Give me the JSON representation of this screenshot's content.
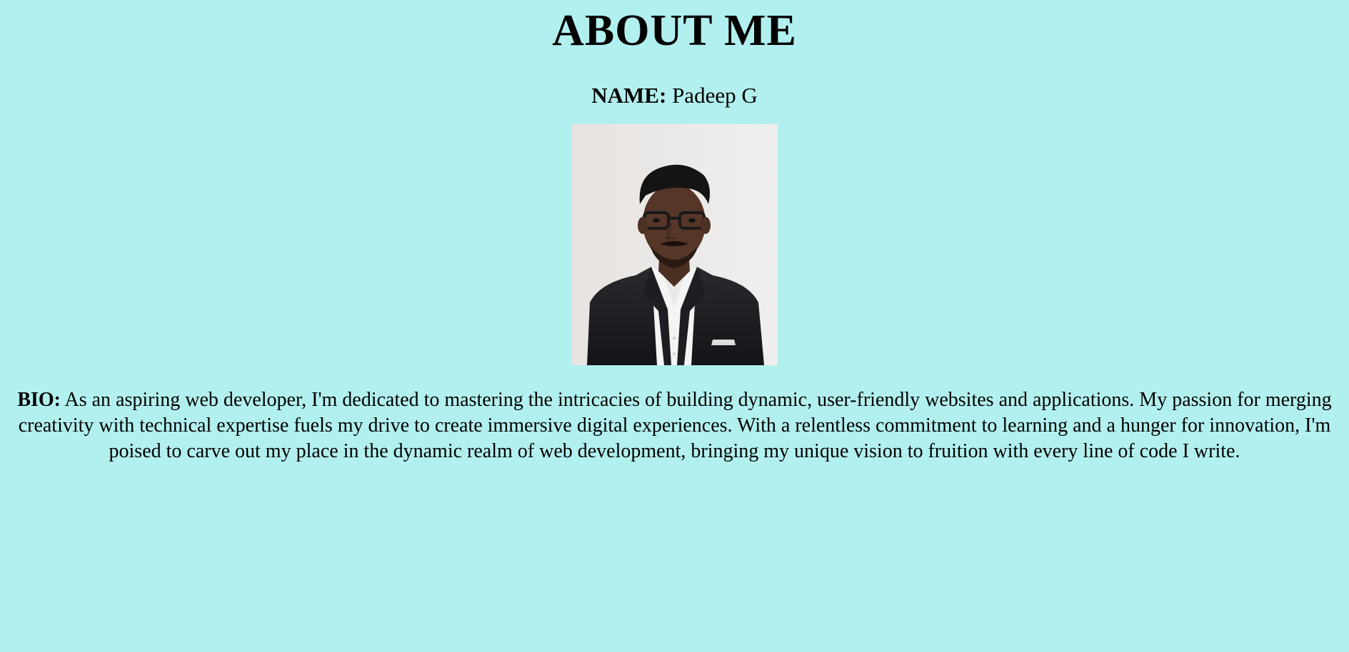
{
  "page": {
    "background_color": "#b2f0ef",
    "title": "ABOUT ME"
  },
  "profile": {
    "name_label": "NAME:",
    "name_value": "Padeep G",
    "photo_icon": "person-portrait",
    "bio_label": "BIO:",
    "bio_text": "As an aspiring web developer, I'm dedicated to mastering the intricacies of building dynamic, user-friendly websites and applications. My passion for merging creativity with technical expertise fuels my drive to create immersive digital experiences. With a relentless commitment to learning and a hunger for innovation, I'm poised to carve out my place in the dynamic realm of web development, bringing my unique vision to fruition with every line of code I write."
  }
}
